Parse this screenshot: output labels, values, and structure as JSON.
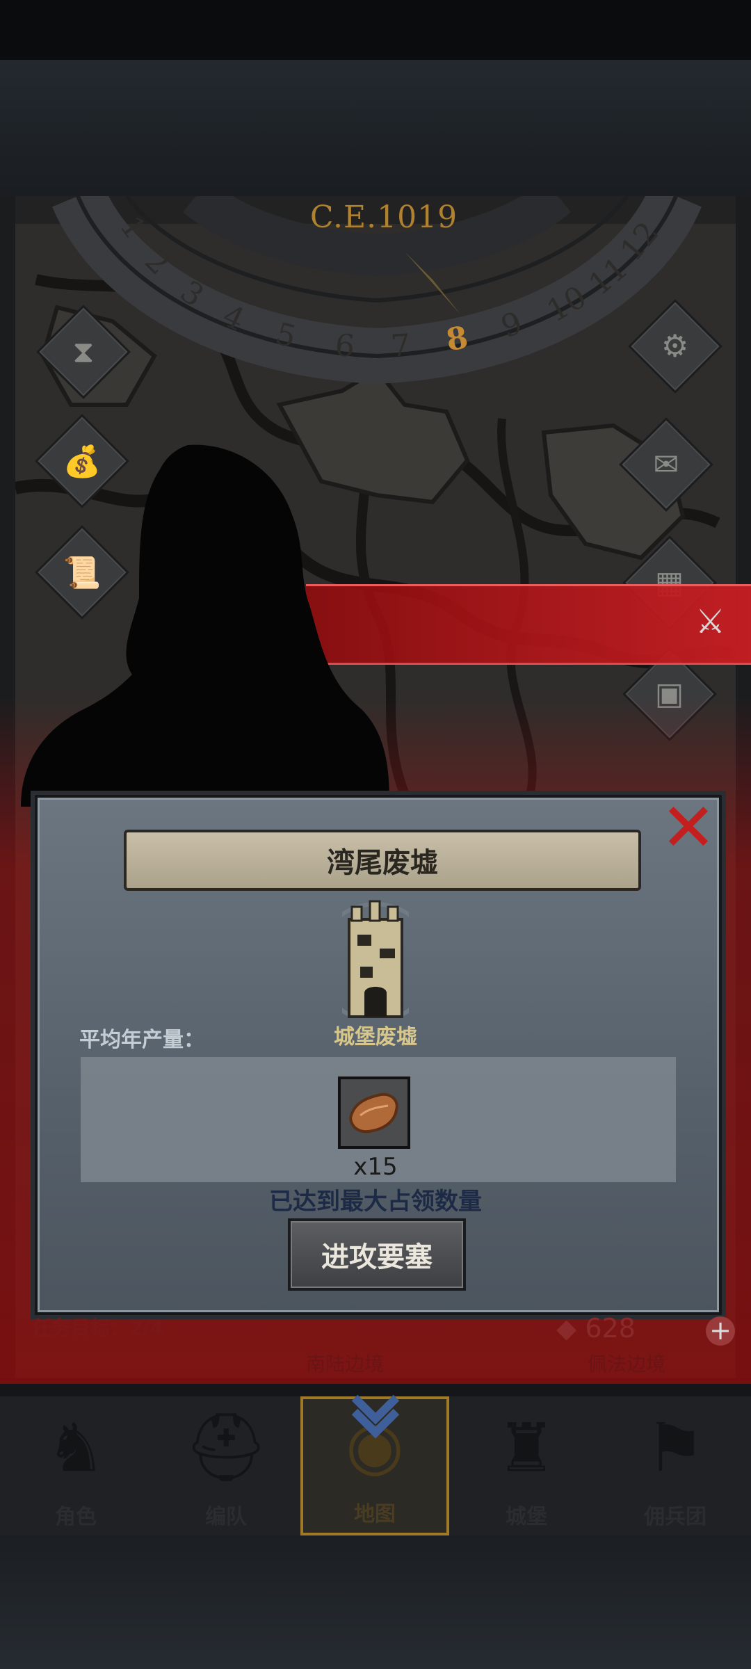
{
  "map": {
    "year": "C.E.1019",
    "months": [
      "1",
      "2",
      "3",
      "4",
      "5",
      "6",
      "7",
      "8",
      "9",
      "10",
      "11",
      "12"
    ],
    "current_month": "8"
  },
  "side_icons_left": [
    "hourglass-icon",
    "money-bag-icon",
    "scroll-icon"
  ],
  "side_icons_right": [
    "gear-icon",
    "mail-icon",
    "gate-icon",
    "supplies-icon"
  ],
  "dialog": {
    "title": "湾尾废墟",
    "building_label": "城堡废墟",
    "yield_label": "平均年产量：",
    "resource_icon": "leather-icon",
    "resource_quantity": "x15",
    "status_text": "已达到最大占领数量",
    "attack_button": "进攻要塞",
    "close_icon": "close-icon"
  },
  "bottom_info": {
    "task_label": "任务目标：2/4",
    "gem_count": "628",
    "location_left": "南陆边境",
    "location_right": "佩法边境"
  },
  "nav": {
    "items": [
      {
        "label": "角色",
        "icon": "knight-icon"
      },
      {
        "label": "编队",
        "icon": "helmet-icon"
      },
      {
        "label": "地图",
        "icon": "map-icon"
      },
      {
        "label": "城堡",
        "icon": "castle-icon"
      },
      {
        "label": "佣兵团",
        "icon": "banner-icon"
      }
    ],
    "active": "地图"
  },
  "colors": {
    "accent_red": "#c41f1f",
    "gold": "#b0812f",
    "dialog_bg": "#5e6872"
  }
}
